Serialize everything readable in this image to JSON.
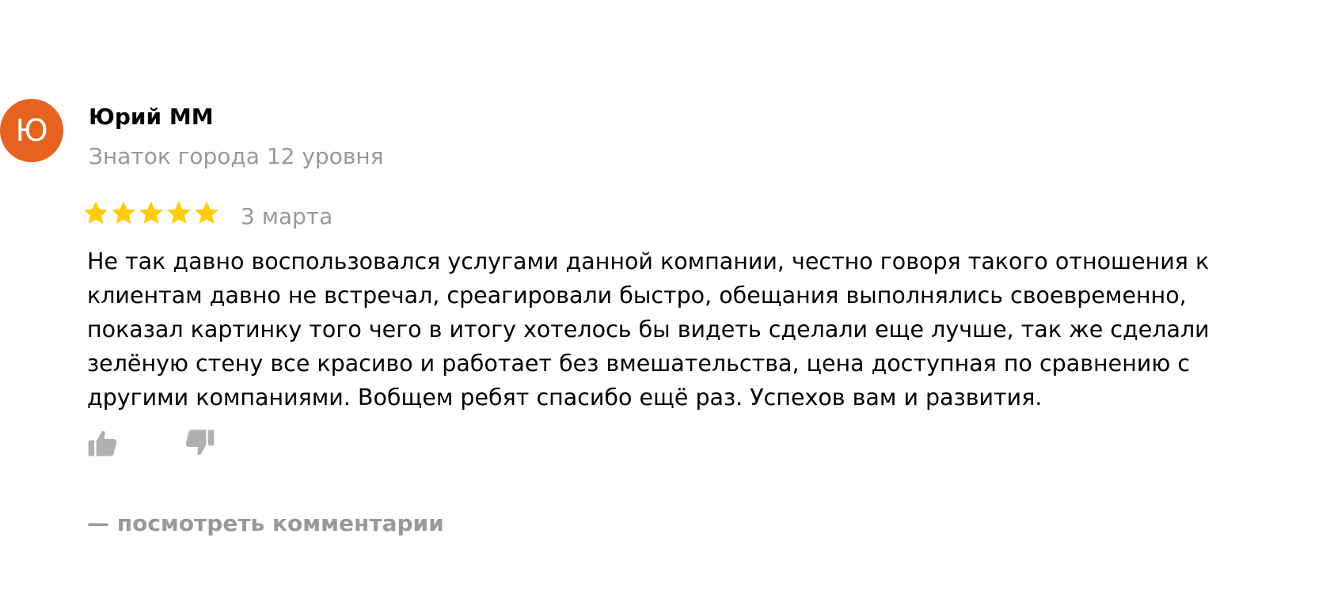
{
  "review": {
    "author": {
      "avatar_letter": "Ю",
      "avatar_color": "#e8621f",
      "name": "Юрий ММ",
      "level": "Знаток города 12 уровня"
    },
    "rating": {
      "stars": 5,
      "max": 5,
      "star_color": "#ffcc00",
      "icon": "star-icon"
    },
    "date": "3 марта",
    "text": "Не так давно воспользовался услугами данной компании, честно говоря такого отношения к клиентам давно не встречал, среагировали быстро, обещания выполнялись своевременно, показал картинку того чего в итогу хотелось бы видеть сделали еще лучше, так же сделали зелёную стену все красиво и работает без вмешательства, цена доступная по сравнению с другими компаниями. Вобщем ребят спасибо ещё раз. Успехов вам и развития.",
    "actions": {
      "like_icon": "thumbs-up-icon",
      "dislike_icon": "thumbs-down-icon",
      "icon_color": "#b0b0b0"
    },
    "comments_link": "— посмотреть комментарии"
  }
}
